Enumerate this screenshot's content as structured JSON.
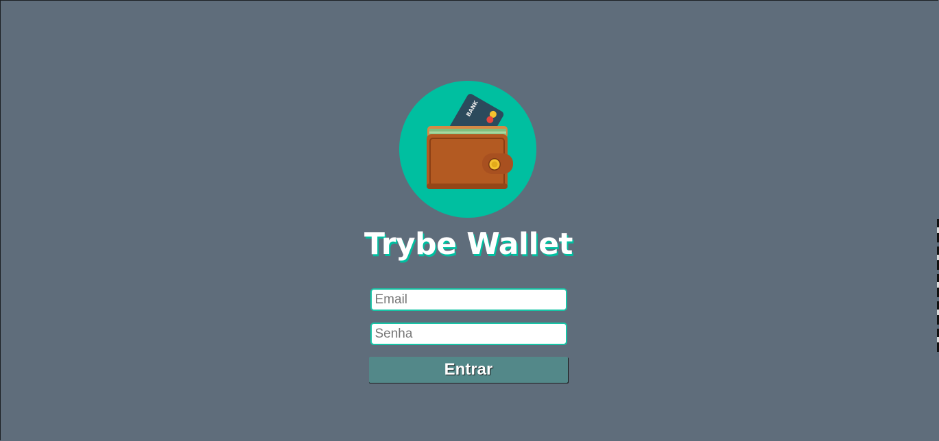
{
  "app": {
    "title": "Trybe Wallet",
    "logo_icon": "wallet-with-bank-card-icon",
    "logo_card_text": "BANK"
  },
  "form": {
    "email": {
      "placeholder": "Email",
      "value": ""
    },
    "password": {
      "placeholder": "Senha",
      "value": ""
    },
    "submit_label": "Entrar"
  },
  "colors": {
    "background": "#5f6d7b",
    "accent": "#00bfa0",
    "button": "#538889",
    "wallet": "#b35a22"
  }
}
